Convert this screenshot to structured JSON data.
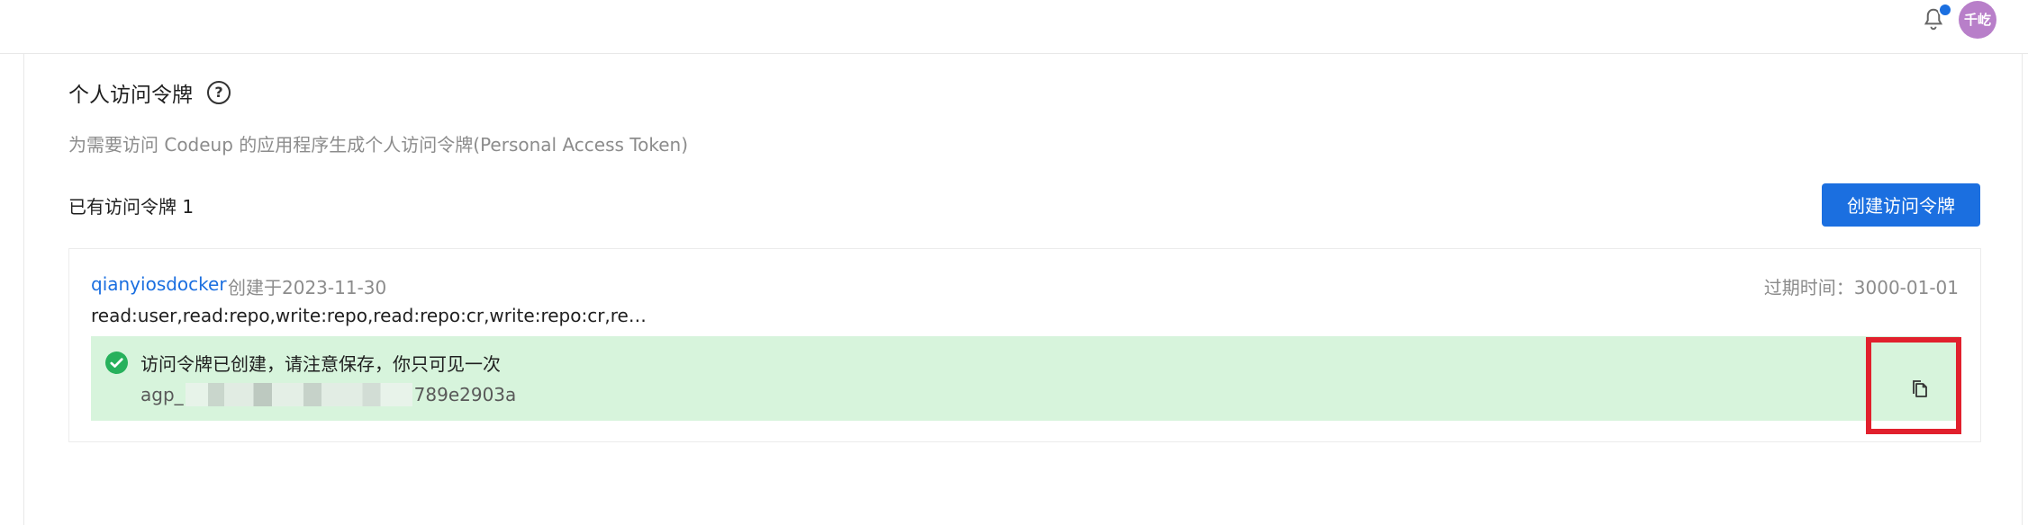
{
  "header": {
    "notification_icon": "bell-icon",
    "avatar_text": "千屹",
    "avatar_color": "#b87fc9",
    "notification_dot_color": "#1b6fe0"
  },
  "section": {
    "title": "个人访问令牌",
    "help_icon": "question-circle-icon",
    "help_text": "?",
    "description": "为需要访问 Codeup 的应用程序生成个人访问令牌(Personal Access Token)",
    "count_label": "已有访问令牌 1",
    "create_button": "创建访问令牌"
  },
  "token": {
    "name": "qianyiosdocker",
    "created": "创建于2023-11-30",
    "expire": "过期时间：3000-01-01",
    "scopes": "read:user,read:repo,write:repo,read:repo:cr,write:repo:cr,re…",
    "notice_title": "访问令牌已创建，请注意保存，你只可见一次",
    "value_prefix": "agp_",
    "value_suffix": "789e2903a",
    "copy_icon": "copy-icon"
  },
  "colors": {
    "accent": "#1b6fe0",
    "success_bg": "#d7f4dc",
    "success_icon": "#27b15c",
    "highlight_border": "#e1202d"
  }
}
